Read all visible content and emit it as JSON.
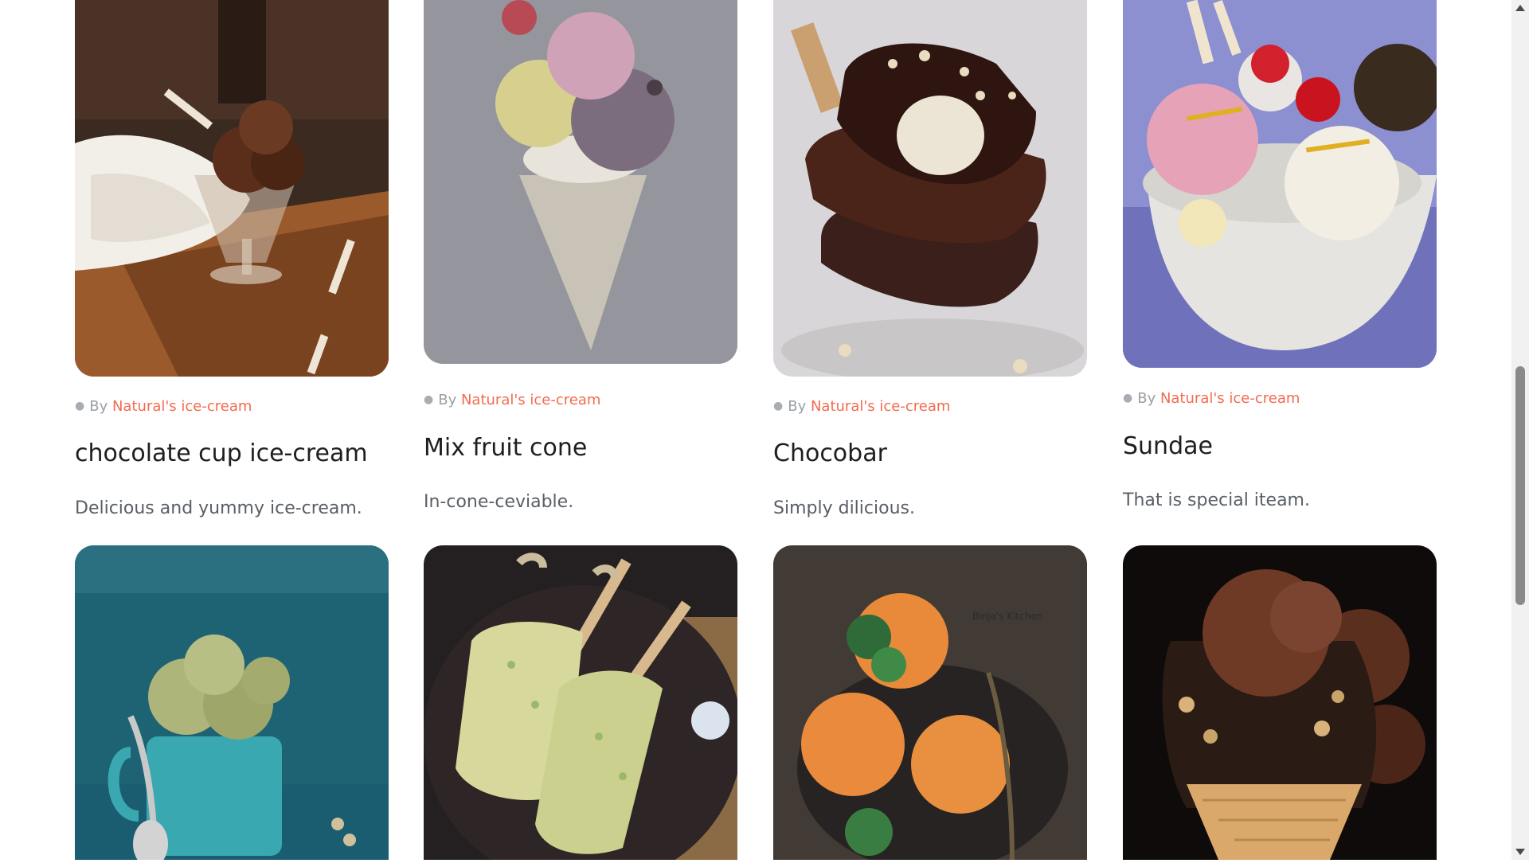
{
  "cards": [
    {
      "by": "By",
      "author": "Natural's ice-cream",
      "title": "chocolate cup ice-cream",
      "description": "Delicious and yummy ice-cream.",
      "image": "chocolate-sundae-glass-image"
    },
    {
      "by": "By",
      "author": "Natural's ice-cream",
      "title": "Mix fruit cone",
      "description": "In-cone-ceviable.",
      "image": "mixed-scoop-cone-image"
    },
    {
      "by": "By",
      "author": "Natural's ice-cream",
      "title": "Chocobar",
      "description": "Simply dilicious.",
      "image": "chocobar-stack-image"
    },
    {
      "by": "By",
      "author": "Natural's ice-cream",
      "title": "Sundae",
      "description": "That is special iteam.",
      "image": "sundae-bowl-image"
    },
    {
      "image": "pistachio-mug-image"
    },
    {
      "image": "kulfi-sticks-image"
    },
    {
      "image": "orange-scoops-image",
      "watermark": "Binja's Kitchen"
    },
    {
      "image": "chocolate-cone-image"
    }
  ],
  "colors": {
    "author": "#f26b4f",
    "title": "#1e1e1e",
    "description": "#595f66",
    "byline": "#9aa0a6"
  },
  "scrollbar": {
    "up_icon": "triangle-up-icon",
    "down_icon": "triangle-down-icon"
  }
}
